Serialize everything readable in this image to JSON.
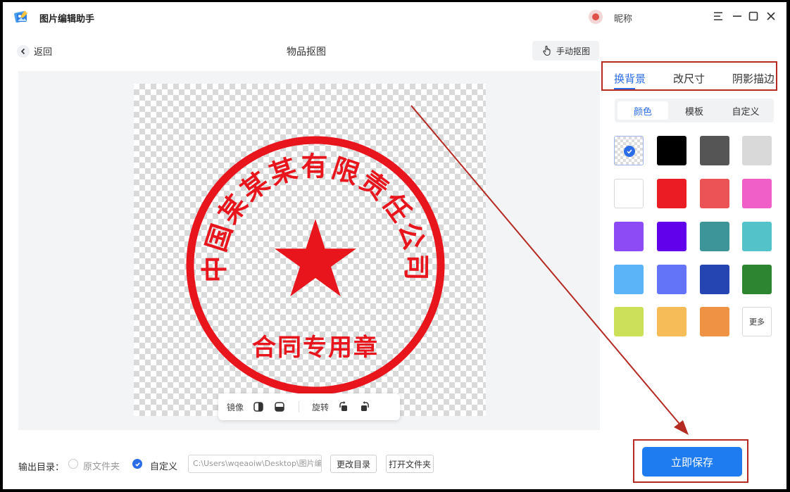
{
  "app": {
    "title": "图片编辑助手",
    "user_nickname": "昵称"
  },
  "header": {
    "back_label": "返回",
    "page_title": "物品抠图",
    "manual_cutout_label": "手动抠图"
  },
  "stamp": {
    "outer_text": "中国某某某有限责任公司",
    "bottom_text": "合同专用章",
    "color": "#e8151d"
  },
  "toolbar": {
    "mirror_label": "镜像",
    "rotate_label": "旋转"
  },
  "panel": {
    "tabs": [
      {
        "label": "换背景",
        "active": true
      },
      {
        "label": "改尺寸",
        "active": false
      },
      {
        "label": "阴影描边",
        "active": false
      }
    ],
    "subtabs": [
      {
        "label": "颜色",
        "active": true
      },
      {
        "label": "模板",
        "active": false
      },
      {
        "label": "自定义",
        "active": false
      }
    ],
    "swatches": [
      {
        "name": "transparent",
        "color": "transparent",
        "selected": true
      },
      {
        "name": "black",
        "color": "#000000"
      },
      {
        "name": "dark-gray",
        "color": "#555555"
      },
      {
        "name": "light-gray",
        "color": "#d9d9d9"
      },
      {
        "name": "white",
        "color": "#ffffff"
      },
      {
        "name": "red",
        "color": "#ec1c24"
      },
      {
        "name": "coral",
        "color": "#ec5357"
      },
      {
        "name": "pink",
        "color": "#ef5fc7"
      },
      {
        "name": "violet",
        "color": "#8d4bf6"
      },
      {
        "name": "purple",
        "color": "#6100ea"
      },
      {
        "name": "teal",
        "color": "#3d959a"
      },
      {
        "name": "cyan",
        "color": "#54c2c9"
      },
      {
        "name": "sky-blue",
        "color": "#5bb3f8"
      },
      {
        "name": "periwinkle",
        "color": "#6474f8"
      },
      {
        "name": "royal-blue",
        "color": "#2545b3"
      },
      {
        "name": "green",
        "color": "#2d8431"
      },
      {
        "name": "lime",
        "color": "#cde059"
      },
      {
        "name": "yellow-orange",
        "color": "#f5bc58"
      },
      {
        "name": "orange",
        "color": "#ef9243"
      }
    ],
    "more_label": "更多"
  },
  "output": {
    "label": "输出目录：",
    "option_original": "原文件夹",
    "option_custom": "自定义",
    "path_value": "C:\\Users\\wqeaoiw\\Desktop\\图片编",
    "change_dir_label": "更改目录",
    "open_folder_label": "打开文件夹"
  },
  "save_label": "立即保存",
  "colors": {
    "accent": "#2b6de8",
    "save_button": "#1f7cf0",
    "annotation_red": "#b52a23"
  }
}
